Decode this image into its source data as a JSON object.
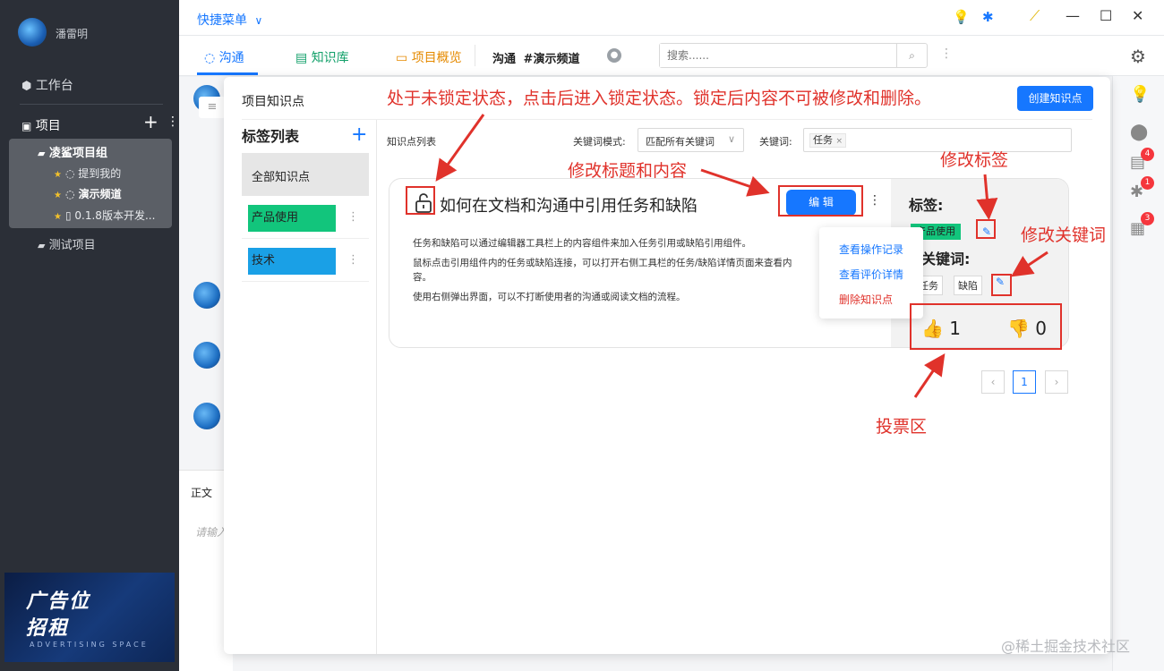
{
  "user": {
    "name": "潘雷明"
  },
  "sidebar": {
    "workbench": "工作台",
    "projects": "项目",
    "group_name": "凌鲨项目组",
    "items": [
      "提到我的",
      "演示频道",
      "0.1.8版本开发..."
    ],
    "test_project": "测试项目"
  },
  "ad": {
    "line1": "广告位",
    "line2": "招租",
    "line3": "ADVERTISING SPACE"
  },
  "topbar": {
    "quick_menu": "快捷菜单"
  },
  "tabs": [
    "沟通",
    "知识库",
    "项目概览"
  ],
  "channel": {
    "label": "沟通",
    "name": "#演示频道"
  },
  "search": {
    "placeholder": "搜索......"
  },
  "right_badges": [
    "4",
    "1",
    "3"
  ],
  "editor": {
    "tab": "正文",
    "placeholder": "请输入..."
  },
  "modal": {
    "title": "项目知识点",
    "create_button": "创建知识点",
    "tag_list_title": "标签列表",
    "tag_all": "全部知识点",
    "tags": [
      {
        "name": "产品使用",
        "color": "#12c57c"
      },
      {
        "name": "技术",
        "color": "#1aa0e6"
      }
    ],
    "list_label": "知识点列表",
    "kw_mode_label": "关键词模式:",
    "kw_mode_value": "匹配所有关键词",
    "kw_label": "关键词:",
    "kw_chip": "任务",
    "card": {
      "title": "如何在文档和沟通中引用任务和缺陷",
      "edit_button": "编 辑",
      "body": [
        "任务和缺陷可以通过编辑器工具栏上的内容组件来加入任务引用或缺陷引用组件。",
        "鼠标点击引用组件内的任务或缺陷连接，可以打开右侧工具栏的任务/缺陷详情页面来查看内",
        "容。",
        "使用右侧弹出界面，可以不打断使用者的沟通或阅读文档的流程。"
      ],
      "tags_label": "标签:",
      "tag_value": "产品使用",
      "keywords_label": "关键词:",
      "keywords": [
        "任务",
        "缺陷"
      ],
      "upvotes": "1",
      "downvotes": "0"
    },
    "menu": [
      "查看操作记录",
      "查看评价详情",
      "删除知识点"
    ],
    "pagination": {
      "current": "1"
    }
  },
  "annotations": {
    "lock": "处于未锁定状态，点击后进入锁定状态。锁定后内容不可被修改和删除。",
    "edit": "修改标题和内容",
    "tags": "修改标签",
    "keywords": "修改关键词",
    "votes": "投票区"
  },
  "footer": {
    "watermark": "@稀土掘金技术社区"
  },
  "colors": {
    "accent": "#1677ff",
    "annotation": "#e0322b",
    "sidebar": "#2b2f37"
  }
}
